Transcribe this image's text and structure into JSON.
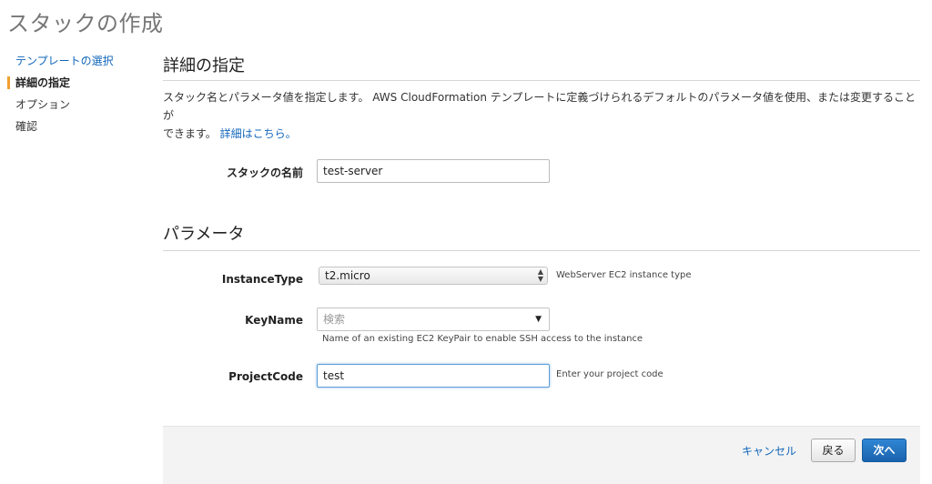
{
  "page": {
    "title": "スタックの作成"
  },
  "steps": [
    {
      "label": "テンプレートの選択",
      "state": "link"
    },
    {
      "label": "詳細の指定",
      "state": "active"
    },
    {
      "label": "オプション",
      "state": "pending"
    },
    {
      "label": "確認",
      "state": "pending"
    }
  ],
  "details": {
    "heading": "詳細の指定",
    "description_line1": "スタック名とパラメータ値を指定します。 AWS CloudFormation テンプレートに定義づけられるデフォルトのパラメータ値を使用、または変更することが",
    "description_line2": "できます。",
    "learn_more": "詳細はこちら。",
    "stack_name_label": "スタックの名前",
    "stack_name_value": "test-server"
  },
  "parameters": {
    "heading": "パラメータ",
    "instance_type": {
      "label": "InstanceType",
      "value": "t2.micro",
      "hint": "WebServer EC2 instance type"
    },
    "key_name": {
      "label": "KeyName",
      "placeholder": "検索",
      "hint": "Name of an existing EC2 KeyPair to enable SSH access to the instance"
    },
    "project_code": {
      "label": "ProjectCode",
      "value": "test",
      "hint": "Enter your project code"
    }
  },
  "footer": {
    "cancel": "キャンセル",
    "back": "戻る",
    "next": "次へ"
  },
  "colors": {
    "accent": "#f0a030",
    "link": "#1166bb",
    "primary_button": "#1a63ad"
  }
}
